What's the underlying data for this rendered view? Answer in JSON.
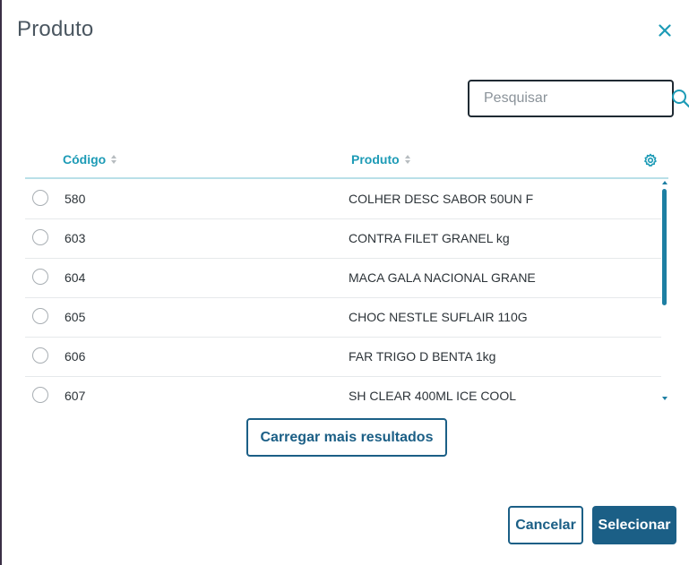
{
  "dialog": {
    "title": "Produto"
  },
  "search": {
    "placeholder": "Pesquisar",
    "value": ""
  },
  "table": {
    "columns": [
      "Código",
      "Produto"
    ],
    "rows": [
      {
        "code": "580",
        "product": "COLHER DESC SABOR 50UN F"
      },
      {
        "code": "603",
        "product": "CONTRA FILET GRANEL kg"
      },
      {
        "code": "604",
        "product": "MACA GALA NACIONAL GRANE"
      },
      {
        "code": "605",
        "product": "CHOC NESTLE SUFLAIR 110G"
      },
      {
        "code": "606",
        "product": "FAR TRIGO D BENTA 1kg"
      },
      {
        "code": "607",
        "product": "SH CLEAR 400ML ICE COOL"
      }
    ]
  },
  "buttons": {
    "load_more": "Carregar mais resultados",
    "cancel": "Cancelar",
    "select": "Selecionar"
  },
  "icons": {
    "close": "close-icon",
    "search": "search-icon",
    "sort": "sort-icon",
    "settings": "gear-icon"
  },
  "colors": {
    "accent": "#1d9bb6",
    "primary": "#1b5f86",
    "text": "#2c3338"
  }
}
